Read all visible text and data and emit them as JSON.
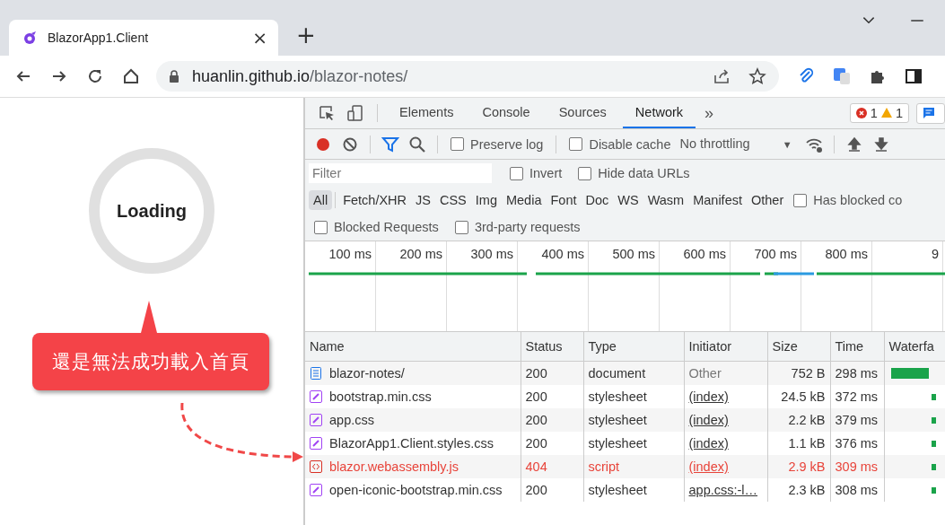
{
  "browser": {
    "tab": {
      "title": "BlazorApp1.Client",
      "close": "×"
    },
    "new_tab": "+",
    "url_host": "huanlin.github.io",
    "url_path": "/blazor-notes/"
  },
  "page": {
    "loading": "Loading",
    "callout": "還是無法成功載入首頁"
  },
  "devtools": {
    "tabs": [
      {
        "label": "Elements",
        "selected": false
      },
      {
        "label": "Console",
        "selected": false
      },
      {
        "label": "Sources",
        "selected": false
      },
      {
        "label": "Network",
        "selected": true
      }
    ],
    "more": "»",
    "errors": "1",
    "warnings": "1",
    "toolbar": {
      "recording": true,
      "filter_active": true,
      "preserve_log": {
        "label": "Preserve log",
        "checked": false
      },
      "disable_cache": {
        "label": "Disable cache",
        "checked": false
      },
      "throttling": "No throttling",
      "dropdown": "▼"
    },
    "filter": {
      "placeholder": "Filter",
      "invert": {
        "label": "Invert",
        "checked": false
      },
      "hide_data_urls": {
        "label": "Hide data URLs",
        "checked": false
      }
    },
    "types": [
      {
        "label": "All",
        "selected": true
      },
      {
        "label": "Fetch/XHR",
        "selected": false
      },
      {
        "label": "JS",
        "selected": false
      },
      {
        "label": "CSS",
        "selected": false
      },
      {
        "label": "Img",
        "selected": false
      },
      {
        "label": "Media",
        "selected": false
      },
      {
        "label": "Font",
        "selected": false
      },
      {
        "label": "Doc",
        "selected": false
      },
      {
        "label": "WS",
        "selected": false
      },
      {
        "label": "Wasm",
        "selected": false
      },
      {
        "label": "Manifest",
        "selected": false
      },
      {
        "label": "Other",
        "selected": false
      }
    ],
    "has_blocked": {
      "label": "Has blocked co",
      "checked": false
    },
    "blocked_requests": {
      "label": "Blocked Requests",
      "checked": false
    },
    "third_party": {
      "label": "3rd-party requests",
      "checked": false
    },
    "timeline_ticks": [
      "100 ms",
      "200 ms",
      "300 ms",
      "400 ms",
      "500 ms",
      "600 ms",
      "700 ms",
      "800 ms",
      "9"
    ],
    "table": {
      "columns": [
        "Name",
        "Status",
        "Type",
        "Initiator",
        "Size",
        "Time",
        "Waterfa"
      ],
      "rows": [
        {
          "kind": "document",
          "name": "blazor-notes/",
          "status": "200",
          "type": "document",
          "initiator": "Other",
          "initiator_link": false,
          "size": "752 B",
          "time": "298 ms",
          "error": false
        },
        {
          "kind": "stylesheet",
          "name": "bootstrap.min.css",
          "status": "200",
          "type": "stylesheet",
          "initiator": "(index)",
          "initiator_link": true,
          "size": "24.5 kB",
          "time": "372 ms",
          "error": false
        },
        {
          "kind": "stylesheet",
          "name": "app.css",
          "status": "200",
          "type": "stylesheet",
          "initiator": "(index)",
          "initiator_link": true,
          "size": "2.2 kB",
          "time": "379 ms",
          "error": false
        },
        {
          "kind": "stylesheet",
          "name": "BlazorApp1.Client.styles.css",
          "status": "200",
          "type": "stylesheet",
          "initiator": "(index)",
          "initiator_link": true,
          "size": "1.1 kB",
          "time": "376 ms",
          "error": false
        },
        {
          "kind": "script",
          "name": "blazor.webassembly.js",
          "status": "404",
          "type": "script",
          "initiator": "(index)",
          "initiator_link": true,
          "size": "2.9 kB",
          "time": "309 ms",
          "error": true
        },
        {
          "kind": "stylesheet",
          "name": "open-iconic-bootstrap.min.css",
          "status": "200",
          "type": "stylesheet",
          "initiator": "app.css:-l…",
          "initiator_link": true,
          "size": "2.3 kB",
          "time": "308 ms",
          "error": false
        }
      ]
    }
  }
}
